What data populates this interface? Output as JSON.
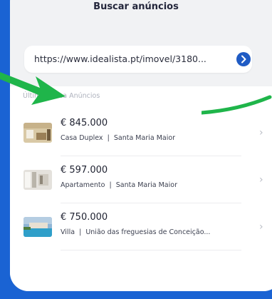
{
  "header": {
    "title": "Buscar anúncios"
  },
  "search": {
    "url_value": "https://www.idealista.pt/imovel/3180...",
    "go_icon": "arrow-right-icon"
  },
  "recent": {
    "label": "Última busca Anúncios",
    "items": [
      {
        "price": "€ 845.000",
        "type": "Casa Duplex",
        "separator": "|",
        "location": "Santa Maria Maior"
      },
      {
        "price": "€ 597.000",
        "type": "Apartamento",
        "separator": "|",
        "location": "Santa Maria Maior"
      },
      {
        "price": "€ 750.000",
        "type": "Villa",
        "separator": "|",
        "location": "União das freguesias de Conceição..."
      }
    ]
  },
  "colors": {
    "background": "#1a63d3",
    "card": "#f1f2f4",
    "accent_button": "#1f5bc4",
    "annotation_arrow": "#1fb54a"
  }
}
